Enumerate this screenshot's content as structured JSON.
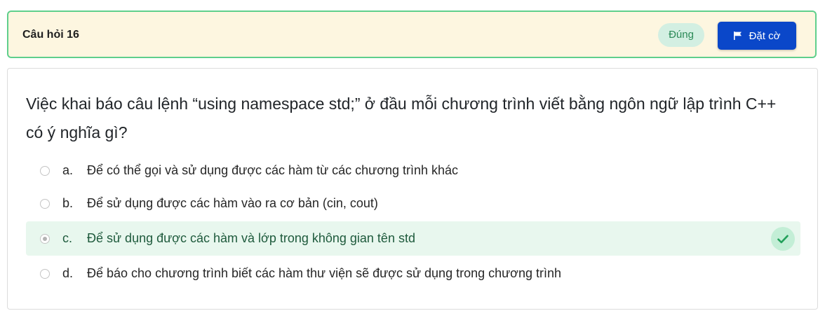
{
  "header": {
    "title": "Câu hỏi 16",
    "status": "Đúng",
    "flag_label": "Đặt cờ",
    "flag_icon": "flag-icon"
  },
  "question": {
    "text": "Việc khai báo câu lệnh “using namespace std;” ở đầu mỗi chương trình viết bằng ngôn ngữ lập trình C++ có ý nghĩa gì?"
  },
  "options": [
    {
      "letter": "a.",
      "text": "Để có thể gọi và sử dụng được các hàm từ các chương trình khác",
      "selected": false,
      "correct": false
    },
    {
      "letter": "b.",
      "text": "Để sử dụng được các hàm vào ra cơ bản (cin, cout)",
      "selected": false,
      "correct": false
    },
    {
      "letter": "c.",
      "text": "Để sử dụng được các hàm và lớp trong không gian tên std",
      "selected": true,
      "correct": true
    },
    {
      "letter": "d.",
      "text": "Để báo cho chương trình biết các hàm thư viện sẽ được sử dụng trong chương trình",
      "selected": false,
      "correct": false
    }
  ],
  "colors": {
    "header_bg": "#fdf6e0",
    "header_border": "#5fcf8c",
    "status_bg": "#d3efe2",
    "status_text": "#2b8a57",
    "flag_button_bg": "#0a47c9",
    "correct_bg": "#e8f7ee",
    "check_icon": "#22a05a"
  }
}
